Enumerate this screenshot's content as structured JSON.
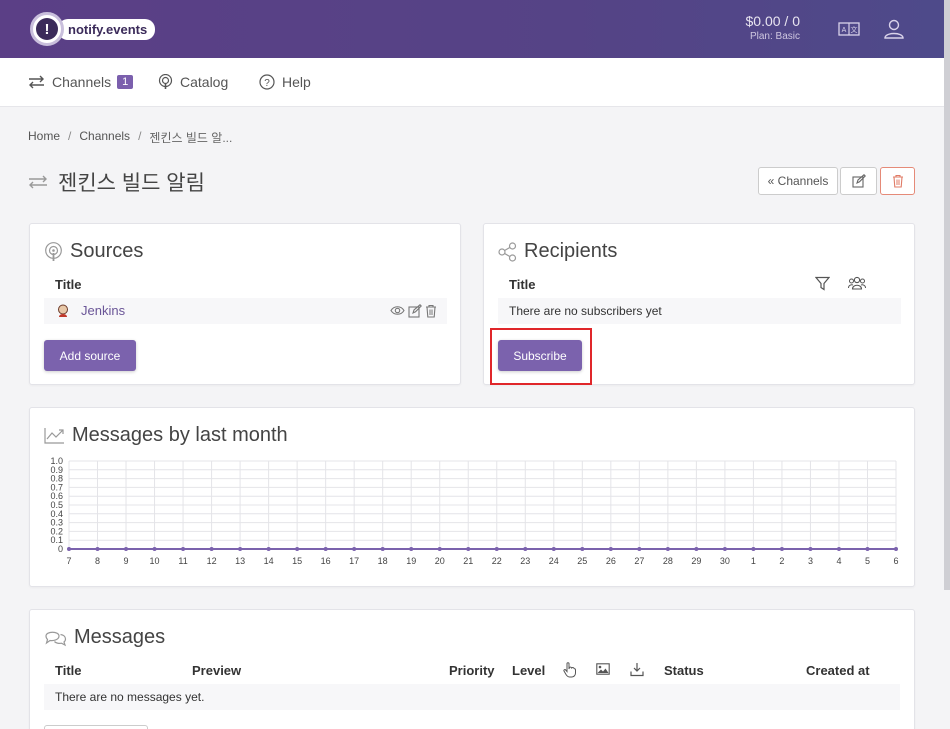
{
  "header": {
    "logo_text": "notify.events",
    "logo_glyph": "!",
    "balance": "$0.00 / 0",
    "plan": "Plan: Basic",
    "brand_color": "#5b3f86"
  },
  "nav": {
    "channels_label": "Channels",
    "channels_count": "1",
    "catalog_label": "Catalog",
    "help_label": "Help"
  },
  "breadcrumb": {
    "home": "Home",
    "channels": "Channels",
    "current": "젠킨스 빌드 알..."
  },
  "page": {
    "title": "젠킨스 빌드 알림",
    "back_label": "« Channels"
  },
  "sources": {
    "title": "Sources",
    "col_title": "Title",
    "items": [
      {
        "name": "Jenkins",
        "icon": "jenkins-icon"
      }
    ],
    "add_label": "Add source"
  },
  "recipients": {
    "title": "Recipients",
    "col_title": "Title",
    "empty_text": "There are no subscribers yet",
    "subscribe_label": "Subscribe"
  },
  "chart": {
    "title": "Messages by last month"
  },
  "chart_data": {
    "type": "line",
    "x": [
      "7",
      "8",
      "9",
      "10",
      "11",
      "12",
      "13",
      "14",
      "15",
      "16",
      "17",
      "18",
      "19",
      "20",
      "21",
      "22",
      "23",
      "24",
      "25",
      "26",
      "27",
      "28",
      "29",
      "30",
      "1",
      "2",
      "3",
      "4",
      "5",
      "6"
    ],
    "series": [
      {
        "values": [
          0,
          0,
          0,
          0,
          0,
          0,
          0,
          0,
          0,
          0,
          0,
          0,
          0,
          0,
          0,
          0,
          0,
          0,
          0,
          0,
          0,
          0,
          0,
          0,
          0,
          0,
          0,
          0,
          0,
          0
        ]
      }
    ],
    "yticks": [
      "0",
      "0.1",
      "0.2",
      "0.3",
      "0.4",
      "0.5",
      "0.6",
      "0.7",
      "0.8",
      "0.9",
      "1.0"
    ],
    "ylim": [
      0,
      1
    ],
    "grid": true,
    "color": "#7b62ad"
  },
  "messages": {
    "title": "Messages",
    "columns": {
      "title": "Title",
      "preview": "Preview",
      "priority": "Priority",
      "level": "Level",
      "status": "Status",
      "created_at": "Created at"
    },
    "empty_text": "There are no messages yet."
  }
}
